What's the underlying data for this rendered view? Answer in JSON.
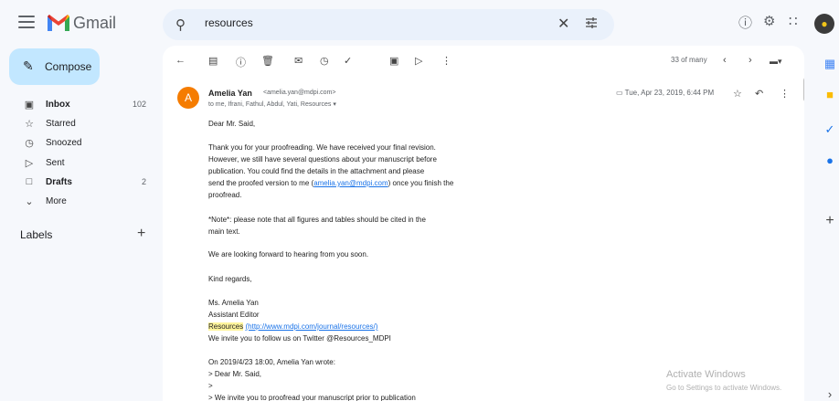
{
  "app": {
    "name": "Gmail"
  },
  "search": {
    "value": "resources"
  },
  "compose": {
    "label": "Compose"
  },
  "nav": [
    {
      "label": "Inbox",
      "count": "102",
      "bold": true,
      "icon": "inbox-icon"
    },
    {
      "label": "Starred",
      "count": "",
      "bold": false,
      "icon": "star-icon"
    },
    {
      "label": "Snoozed",
      "count": "",
      "bold": false,
      "icon": "clock-icon"
    },
    {
      "label": "Sent",
      "count": "",
      "bold": false,
      "icon": "send-icon"
    },
    {
      "label": "Drafts",
      "count": "2",
      "bold": true,
      "icon": "draft-icon"
    },
    {
      "label": "More",
      "count": "",
      "bold": false,
      "icon": "chevron-down-icon"
    }
  ],
  "labels": {
    "heading": "Labels"
  },
  "toolbar": {
    "pager": "33 of many"
  },
  "message": {
    "sender_name": "Amelia Yan",
    "sender_email": "<amelia.yan@mdpi.com>",
    "sender_initial": "A",
    "recipients": "to me, Ifrani, Fathul, Abdul, Yati, Resources",
    "date": "Tue, Apr 23, 2019, 6:44 PM",
    "greeting": "Dear Mr. Said,",
    "p1_a": "Thank you for your proofreading. We have received your final revision.",
    "p1_b": "However, we still have several questions about your manuscript before",
    "p1_c": "publication. You could find the details in the attachment and please",
    "p1_d_pre": "send the proofed version to me (",
    "p1_d_link": "amelia.yan@mdpi.com",
    "p1_d_post": ") once you finish the",
    "p1_e": "proofread.",
    "note_a": "*Note*: please note that all figures and tables should be cited in the",
    "note_b": "main text.",
    "p3": "We are looking forward to hearing from you soon.",
    "closing": "Kind regards,",
    "sig_name": "Ms. Amelia Yan",
    "sig_title": "Assistant Editor",
    "sig_journal": "Resources",
    "sig_url": "(http://www.mdpi.com/journal/resources/)",
    "sig_twitter": "We invite you to follow us on Twitter @Resources_MDPI",
    "quote_header": "On 2019/4/23 18:00, Amelia Yan wrote:",
    "quote_1": "> Dear Mr. Said,",
    "quote_2": ">",
    "quote_3": "> We invite you to proofread your manuscript prior to publication"
  },
  "watermark": {
    "line1": "Activate Windows",
    "line2": "Go to Settings to activate Windows."
  }
}
